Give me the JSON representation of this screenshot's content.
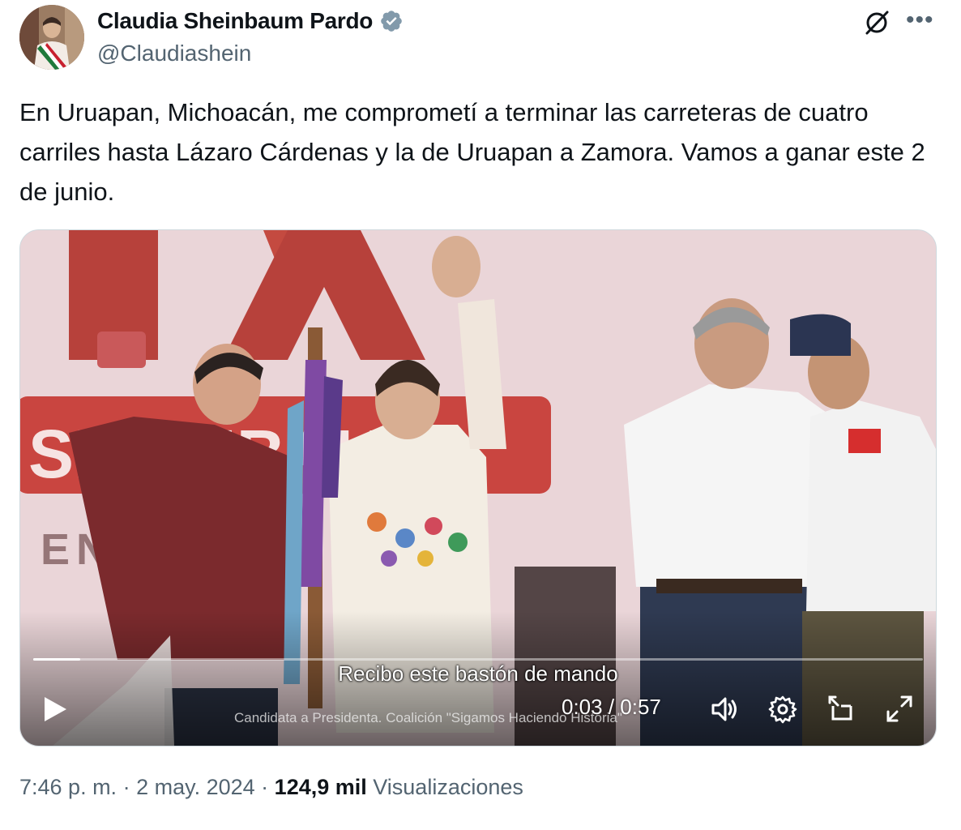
{
  "author": {
    "name": "Claudia Sheinbaum Pardo",
    "handle": "@Claudiashein",
    "verified": true,
    "verified_color": "#829aab"
  },
  "icons": {
    "grok": "grok-slash-icon",
    "more": "more-dots-icon",
    "play": "play-icon",
    "volume": "volume-icon",
    "settings": "gear-icon",
    "pip": "picture-in-picture-icon",
    "fullscreen": "expand-icon"
  },
  "tweet": {
    "text": "En Uruapan, Michoacán, me comprometí a terminar las carreteras de cuatro carriles hasta Lázaro Cárdenas y la de Uruapan a Zamora. Vamos a ganar este 2 de junio."
  },
  "video": {
    "subtitle": "Recibo este bastón de mando",
    "caption": "Candidata a Presidenta. Coalición \"Sigamos Haciendo Historia\"",
    "current_time": "0:03",
    "duration": "0:57",
    "time_display": "0:03 / 0:57",
    "progress_fraction": 0.053
  },
  "footer": {
    "time": "7:46 p. m.",
    "separator": " · ",
    "date": "2 may. 2024",
    "views_count": "124,9 mil",
    "views_label": "Visualizaciones"
  },
  "colors": {
    "text": "#0f1419",
    "secondary": "#536471",
    "border": "#cfd9de"
  }
}
